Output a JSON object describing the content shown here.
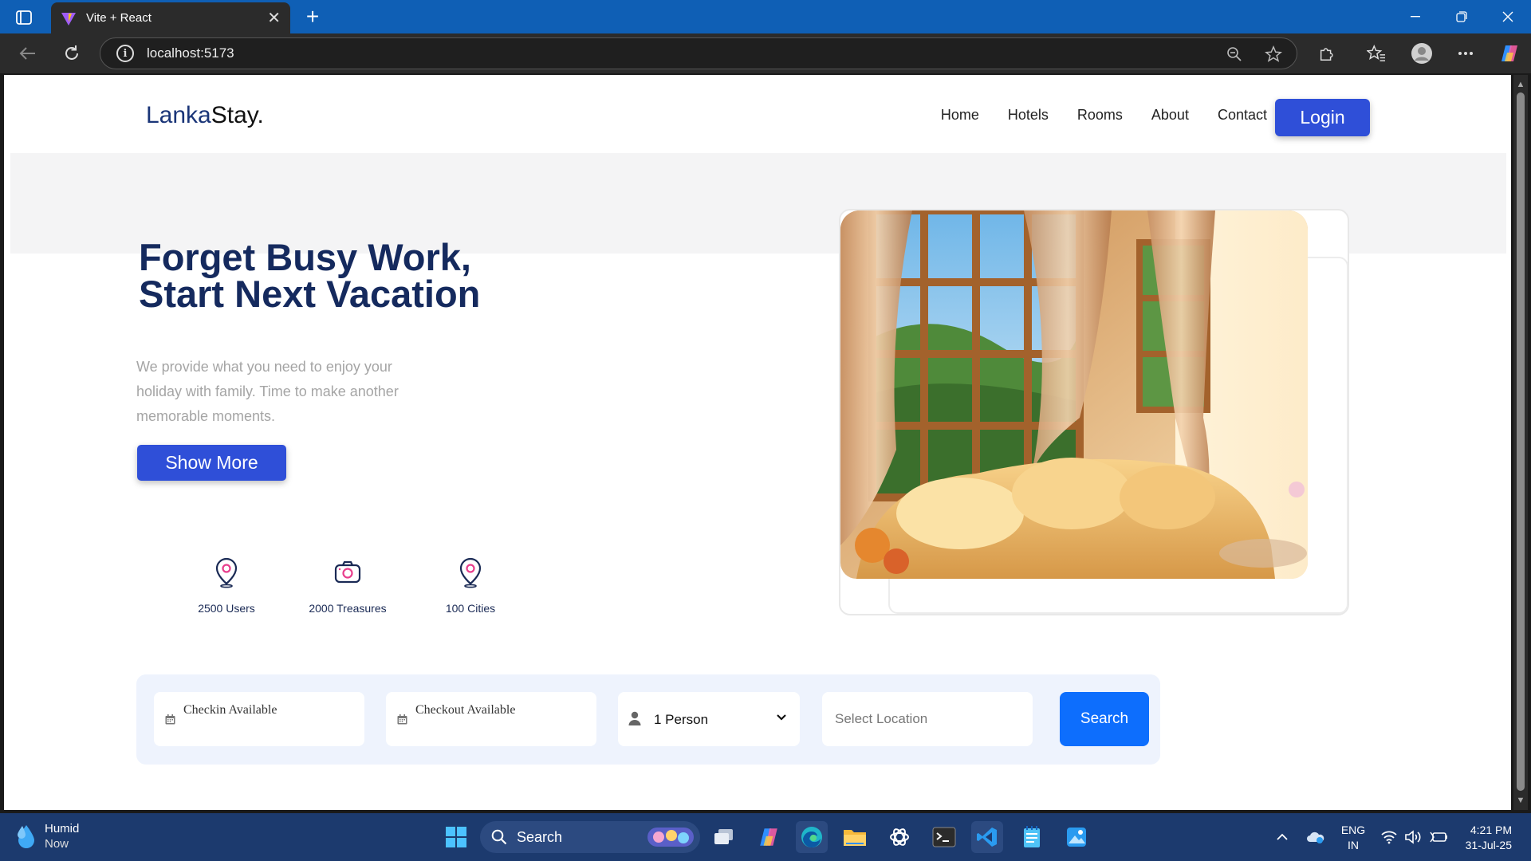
{
  "browser": {
    "tab_title": "Vite + React",
    "url": "localhost:5173"
  },
  "site": {
    "logo_part1": "Lanka",
    "logo_part2": "Stay.",
    "nav": [
      "Home",
      "Hotels",
      "Rooms",
      "About",
      "Contact"
    ],
    "login_label": "Login"
  },
  "hero": {
    "title_line1": "Forget Busy Work,",
    "title_line2": "Start Next Vacation",
    "description": "We provide what you need to enjoy your holiday with family. Time to make another memorable moments.",
    "show_more_label": "Show More",
    "stats": [
      {
        "label": "2500 Users",
        "icon": "map-pin-icon"
      },
      {
        "label": "2000 Treasures",
        "icon": "camera-icon"
      },
      {
        "label": "100 Cities",
        "icon": "map-pin-icon"
      }
    ]
  },
  "search": {
    "checkin": "Checkin Available",
    "checkout": "Checkout Available",
    "persons": "1 Person",
    "location_placeholder": "Select Location",
    "search_label": "Search"
  },
  "taskbar": {
    "weather_title": "Humid",
    "weather_sub": "Now",
    "search_label": "Search",
    "lang_line1": "ENG",
    "lang_line2": "IN",
    "time": "4:21 PM",
    "date": "31-Jul-25"
  },
  "colors": {
    "brand_blue": "#2f4fd8",
    "title_navy": "#152a5e",
    "search_blue": "#0d6efd",
    "titlebar": "#0f5fb5",
    "taskbar": "#1c3a6e"
  }
}
